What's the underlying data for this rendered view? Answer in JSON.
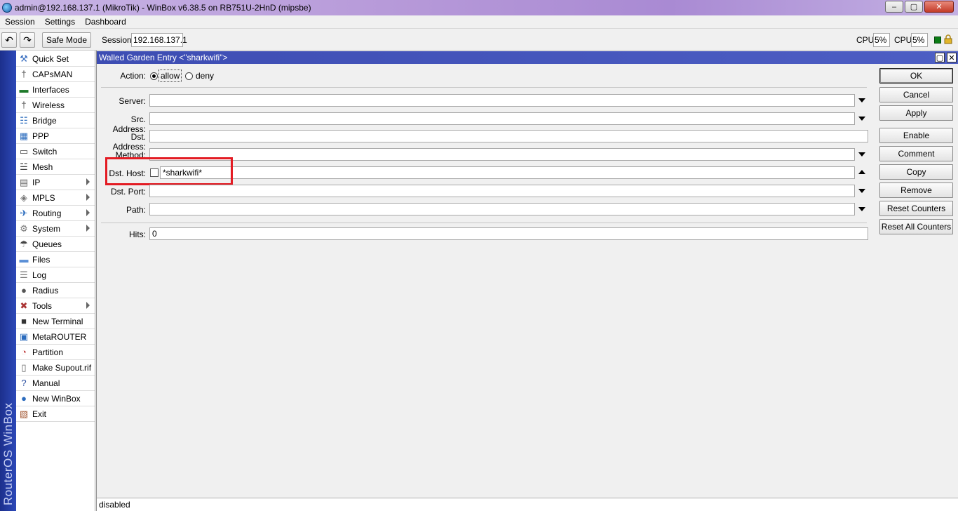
{
  "window": {
    "title": "admin@192.168.137.1 (MikroTik) - WinBox v6.38.5 on RB751U-2HnD (mipsbe)",
    "minimize": "‒",
    "maximize": "▢",
    "close": "✕"
  },
  "menu": [
    "Session",
    "Settings",
    "Dashboard"
  ],
  "toolbar": {
    "undo": "↶",
    "redo": "↷",
    "safe_mode": "Safe Mode",
    "session_label": "Session:",
    "session_value": "192.168.137.1",
    "cpu_label_1": "CPU:",
    "cpu_value_1": "5%",
    "cpu_label_2": "CPU:",
    "cpu_value_2": "5%"
  },
  "brand": "RouterOS WinBox",
  "nav": [
    {
      "label": "Quick Set",
      "icon": "quick-set-icon",
      "submenu": false
    },
    {
      "label": "CAPsMAN",
      "icon": "capsman-icon",
      "submenu": false
    },
    {
      "label": "Interfaces",
      "icon": "interfaces-icon",
      "submenu": false
    },
    {
      "label": "Wireless",
      "icon": "wireless-icon",
      "submenu": false
    },
    {
      "label": "Bridge",
      "icon": "bridge-icon",
      "submenu": false
    },
    {
      "label": "PPP",
      "icon": "ppp-icon",
      "submenu": false
    },
    {
      "label": "Switch",
      "icon": "switch-icon",
      "submenu": false
    },
    {
      "label": "Mesh",
      "icon": "mesh-icon",
      "submenu": false
    },
    {
      "label": "IP",
      "icon": "ip-icon",
      "submenu": true
    },
    {
      "label": "MPLS",
      "icon": "mpls-icon",
      "submenu": true
    },
    {
      "label": "Routing",
      "icon": "routing-icon",
      "submenu": true
    },
    {
      "label": "System",
      "icon": "system-icon",
      "submenu": true
    },
    {
      "label": "Queues",
      "icon": "queues-icon",
      "submenu": false
    },
    {
      "label": "Files",
      "icon": "files-icon",
      "submenu": false
    },
    {
      "label": "Log",
      "icon": "log-icon",
      "submenu": false
    },
    {
      "label": "Radius",
      "icon": "radius-icon",
      "submenu": false
    },
    {
      "label": "Tools",
      "icon": "tools-icon",
      "submenu": true
    },
    {
      "label": "New Terminal",
      "icon": "terminal-icon",
      "submenu": false
    },
    {
      "label": "MetaROUTER",
      "icon": "metarouter-icon",
      "submenu": false
    },
    {
      "label": "Partition",
      "icon": "partition-icon",
      "submenu": false
    },
    {
      "label": "Make Supout.rif",
      "icon": "supout-icon",
      "submenu": false
    },
    {
      "label": "Manual",
      "icon": "manual-icon",
      "submenu": false
    },
    {
      "label": "New WinBox",
      "icon": "winbox-icon",
      "submenu": false
    },
    {
      "label": "Exit",
      "icon": "exit-icon",
      "submenu": false
    }
  ],
  "dialog": {
    "title": "Walled Garden Entry <\"sharkwifi\">",
    "restore": "▢",
    "close": "✕",
    "action_label": "Action:",
    "action_allow": "allow",
    "action_deny": "deny",
    "server_label": "Server:",
    "server_value": "",
    "src_address_label": "Src. Address:",
    "src_address_value": "",
    "dst_address_label": "Dst. Address:",
    "dst_address_value": "",
    "method_label": "Method:",
    "method_value": "",
    "dst_host_label": "Dst. Host:",
    "dst_host_value": "*sharkwifi*",
    "dst_port_label": "Dst. Port:",
    "dst_port_value": "",
    "path_label": "Path:",
    "path_value": "",
    "hits_label": "Hits:",
    "hits_value": "0",
    "status": "disabled"
  },
  "buttons": {
    "ok": "OK",
    "cancel": "Cancel",
    "apply": "Apply",
    "enable": "Enable",
    "comment": "Comment",
    "copy": "Copy",
    "remove": "Remove",
    "reset_counters": "Reset Counters",
    "reset_all_counters": "Reset All Counters"
  }
}
